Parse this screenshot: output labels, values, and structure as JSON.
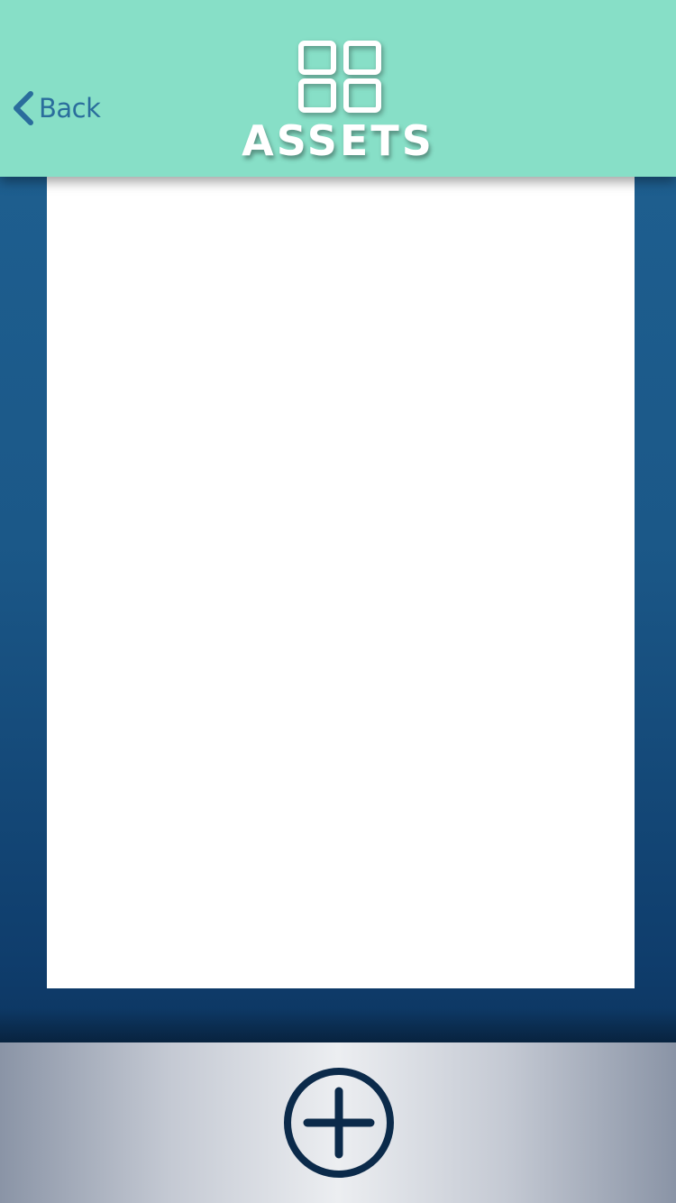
{
  "header": {
    "back_label": "Back",
    "title": "ASSETS",
    "title_icon": "grid-icon",
    "background_color": "#87dfc7"
  },
  "content": {
    "panel_color": "#ffffff"
  },
  "toolbar": {
    "add_icon": "plus-circle-icon",
    "icon_color": "#0b2a4a"
  },
  "colors": {
    "back_text": "#2a6d9c",
    "page_background": "#1b5888"
  }
}
